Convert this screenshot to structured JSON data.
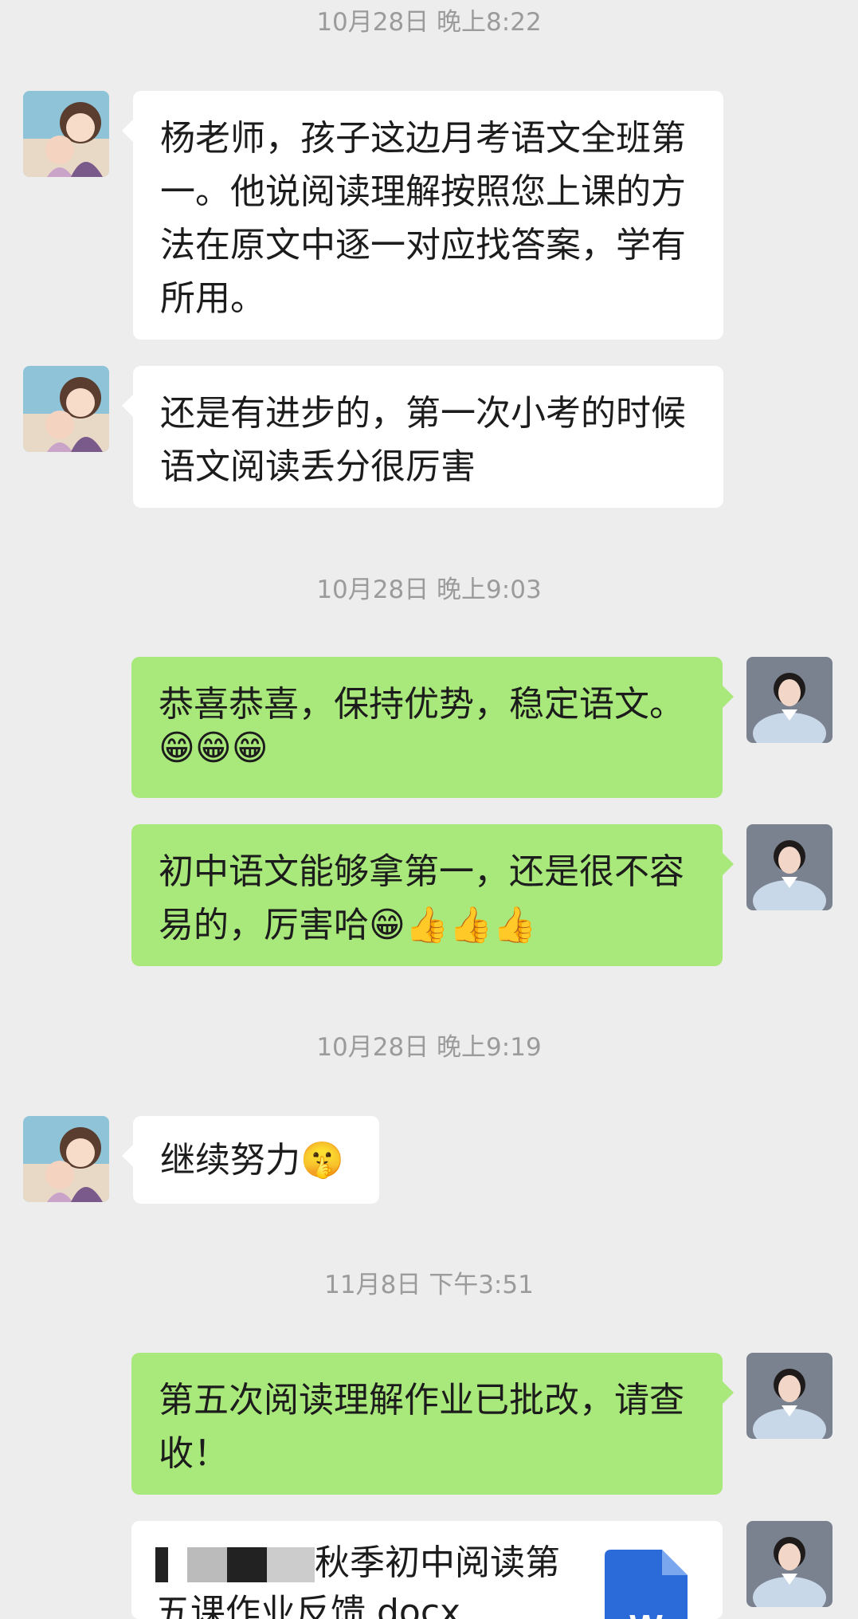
{
  "timestamps": [
    "10月28日 晚上8:22",
    "10月28日 晚上9:03",
    "10月28日 晚上9:19",
    "11月8日 下午3:51"
  ],
  "messages": {
    "m1": "杨老师，孩子这边月考语文全班第一。他说阅读理解按照您上课的方法在原文中逐一对应找答案，学有所用。",
    "m2": "还是有进步的，第一次小考的时候语文阅读丢分很厉害",
    "m3_text": "恭喜恭喜，保持优势，稳定语文。",
    "m3_emojis": "😁😁😁",
    "m4_text": "初中语文能够拿第一，还是很不容易的，厉害哈",
    "m4_emojis": "😁👍👍👍",
    "m5_text": "继续努力",
    "m5_emoji": "🤫",
    "m6": "第五次阅读理解作业已批改，请查收！"
  },
  "file": {
    "name_visible": "秋季初中阅读第",
    "name_line2": "五课作业反馈.docx",
    "icon_letter": "W",
    "icon": "word-doc-icon"
  },
  "colors": {
    "incoming": "#ffffff",
    "outgoing": "#a9e87a",
    "background": "#ededed"
  }
}
